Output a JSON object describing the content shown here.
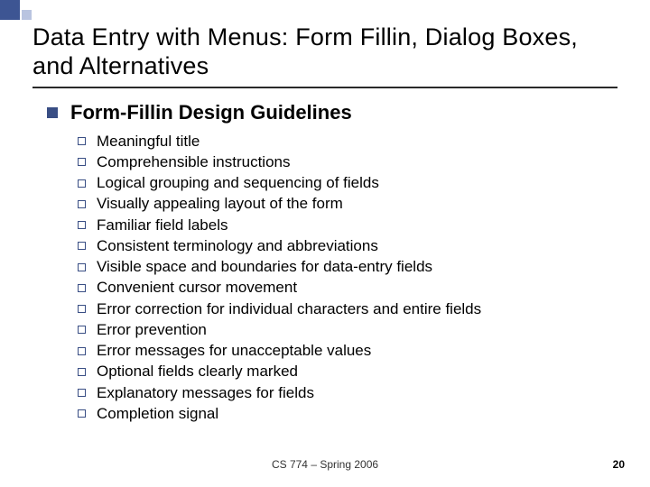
{
  "title": "Data Entry with Menus: Form Fillin, Dialog Boxes, and Alternatives",
  "heading": "Form-Fillin Design Guidelines",
  "items": [
    "Meaningful title",
    "Comprehensible instructions",
    "Logical grouping and sequencing of fields",
    "Visually appealing layout of the form",
    "Familiar field labels",
    "Consistent terminology and abbreviations",
    "Visible space and boundaries for data-entry fields",
    "Convenient cursor movement",
    "Error correction for individual characters and entire fields",
    "Error prevention",
    "Error messages for unacceptable values",
    "Optional fields clearly marked",
    "Explanatory messages for fields",
    "Completion signal"
  ],
  "footer": {
    "center": "CS 774 – Spring 2006",
    "page": "20"
  }
}
